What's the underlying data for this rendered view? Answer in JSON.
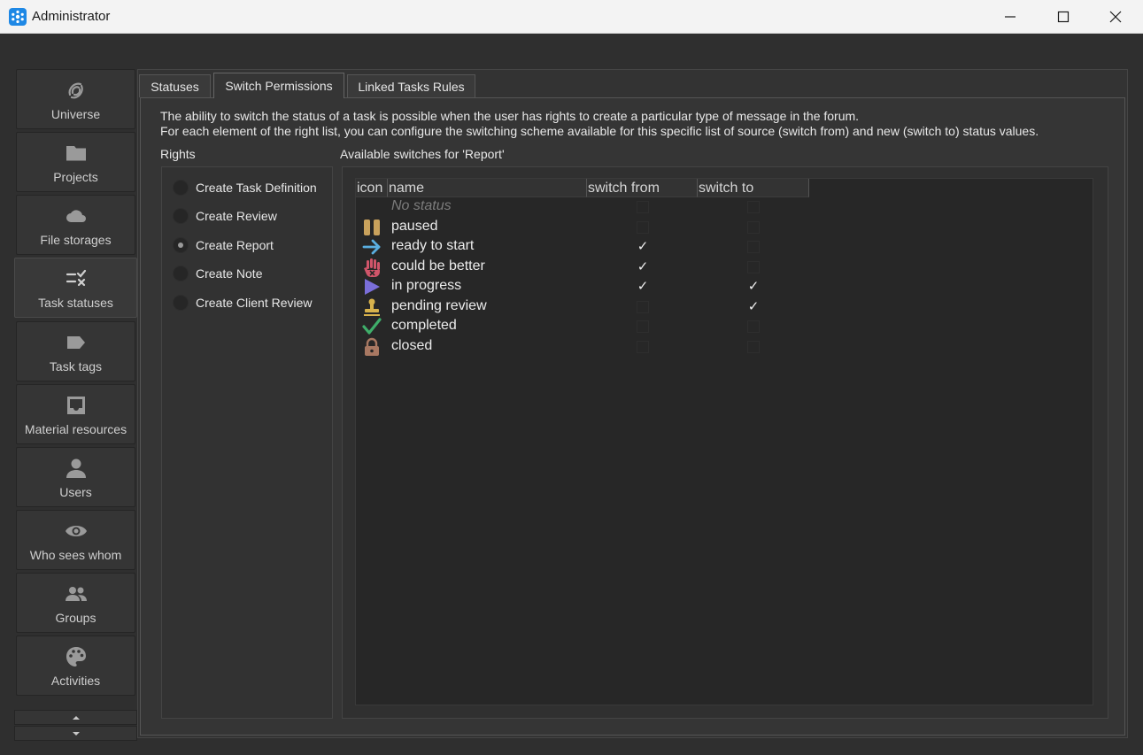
{
  "window": {
    "title": "Administrator",
    "controls": {
      "minimize": "minimize",
      "maximize": "maximize",
      "close": "close"
    }
  },
  "nav": {
    "items": [
      {
        "label": "Universe",
        "icon": "universe-icon"
      },
      {
        "label": "Projects",
        "icon": "folder-icon"
      },
      {
        "label": "File storages",
        "icon": "cloud-icon"
      },
      {
        "label": "Task statuses",
        "icon": "status-list-icon",
        "active": true
      },
      {
        "label": "Task tags",
        "icon": "tag-icon"
      },
      {
        "label": "Material resources",
        "icon": "inbox-icon"
      },
      {
        "label": "Users",
        "icon": "user-icon"
      },
      {
        "label": "Who sees whom",
        "icon": "eye-icon"
      },
      {
        "label": "Groups",
        "icon": "group-icon"
      },
      {
        "label": "Activities",
        "icon": "palette-icon"
      }
    ]
  },
  "tabs": [
    {
      "label": "Statuses"
    },
    {
      "label": "Switch Permissions",
      "active": true
    },
    {
      "label": "Linked Tasks Rules"
    }
  ],
  "description": {
    "line1": "The ability to switch the status of a task is possible when the user has rights to create a particular type of message in the forum.",
    "line2": "For each element of the right list, you can configure the switching scheme available for this specific list of source (switch from) and new (switch to) status values."
  },
  "rights": {
    "label": "Rights",
    "items": [
      {
        "label": "Create Task Definition",
        "checked": false
      },
      {
        "label": "Create Review",
        "checked": false
      },
      {
        "label": "Create Report",
        "checked": true
      },
      {
        "label": "Create Note",
        "checked": false
      },
      {
        "label": "Create Client Review",
        "checked": false
      }
    ]
  },
  "switches": {
    "label": "Available switches for 'Report'",
    "columns": {
      "icon": "icon",
      "name": "name",
      "from": "switch from",
      "to": "switch to"
    },
    "rows": [
      {
        "name": "No status",
        "icon": "none",
        "from": false,
        "to": false,
        "muted": true
      },
      {
        "name": "paused",
        "icon": "pause-icon",
        "color": "#c9a25c",
        "from": false,
        "to": false
      },
      {
        "name": "ready to start",
        "icon": "arrow-right-icon",
        "color": "#5aaee0",
        "from": true,
        "to": false
      },
      {
        "name": "could be better",
        "icon": "hand-stop-icon",
        "color": "#d0556a",
        "from": true,
        "to": false
      },
      {
        "name": "in progress",
        "icon": "play-icon",
        "color": "#7a6ed9",
        "from": true,
        "to": true
      },
      {
        "name": "pending review",
        "icon": "stamp-icon",
        "color": "#d8b24c",
        "from": false,
        "to": true
      },
      {
        "name": "completed",
        "icon": "checkmark-icon",
        "color": "#3fae6a",
        "from": false,
        "to": false
      },
      {
        "name": "closed",
        "icon": "lock-icon",
        "color": "#a87862",
        "from": false,
        "to": false
      }
    ],
    "check_glyph": "✓"
  }
}
